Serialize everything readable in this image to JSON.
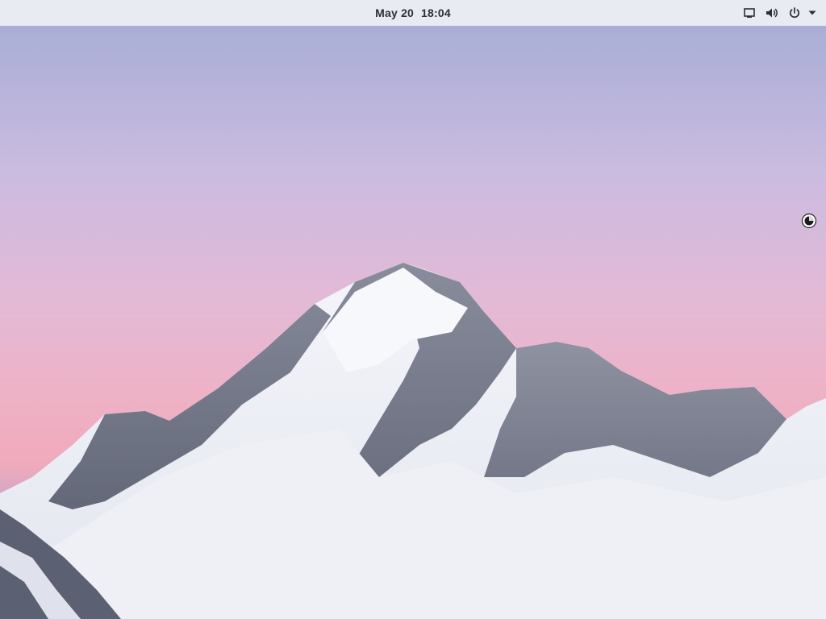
{
  "topbar": {
    "date": "May 20",
    "time": "18:04",
    "status_icons": [
      "screen-icon",
      "volume-icon",
      "power-icon",
      "menu-arrow-icon"
    ]
  },
  "desktop": {
    "wallpaper": "snowy-mountain-peak-at-dusk",
    "sky_colors": [
      "#a9aed6",
      "#d6bfe0",
      "#ebb4c8",
      "#f0a9b8",
      "#9ea7cf"
    ],
    "cursor": "busy-cursor-icon"
  }
}
